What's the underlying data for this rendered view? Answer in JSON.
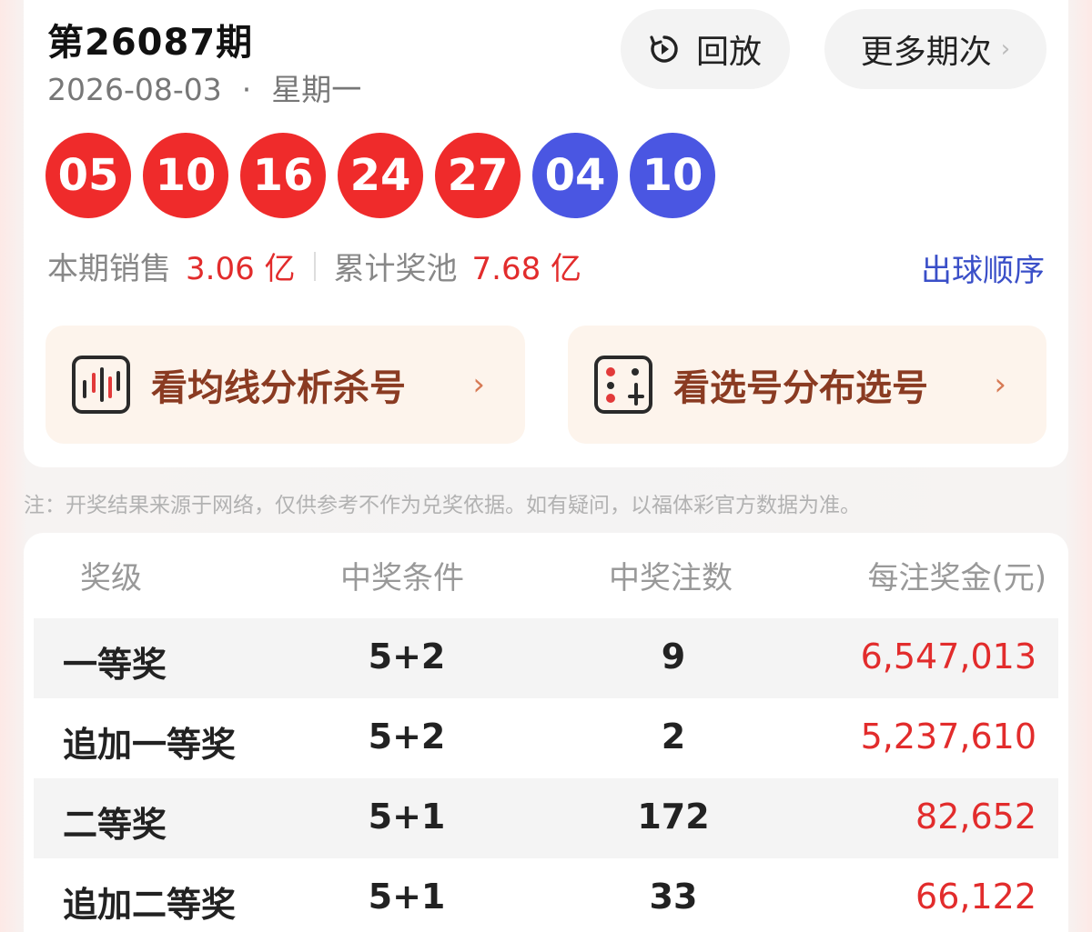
{
  "header": {
    "issue_title": "第26087期",
    "date": "2026-08-03",
    "dot": "·",
    "weekday": "星期一",
    "replay_label": "回放",
    "more_label": "更多期次",
    "more_chevron": "›"
  },
  "balls": [
    {
      "num": "05",
      "color": "#ef2b2b"
    },
    {
      "num": "10",
      "color": "#ef2b2b"
    },
    {
      "num": "16",
      "color": "#ef2b2b"
    },
    {
      "num": "24",
      "color": "#ef2b2b"
    },
    {
      "num": "27",
      "color": "#ef2b2b"
    },
    {
      "num": "04",
      "color": "#4a56e2"
    },
    {
      "num": "10",
      "color": "#4a56e2"
    }
  ],
  "stats": {
    "sales_label": "本期销售",
    "sales_value": "3.06 亿",
    "pool_label": "累计奖池",
    "pool_value": "7.68 亿",
    "order_link": "出球顺序"
  },
  "banners": [
    {
      "text": "看均线分析杀号",
      "icon": "chart-lines-icon",
      "chevron": "›"
    },
    {
      "text": "看选号分布选号",
      "icon": "dice-distribution-icon",
      "chevron": "›"
    }
  ],
  "note": "注：开奖结果来源于网络，仅供参考不作为兑奖依据。如有疑问，以福体彩官方数据为准。",
  "table": {
    "headers": [
      "奖级",
      "中奖条件",
      "中奖注数",
      "每注奖金(元)"
    ],
    "rows": [
      {
        "level": "一等奖",
        "cond": "5+2",
        "count": "9",
        "prize": "6,547,013"
      },
      {
        "level": "追加一等奖",
        "cond": "5+2",
        "count": "2",
        "prize": "5,237,610"
      },
      {
        "level": "二等奖",
        "cond": "5+1",
        "count": "172",
        "prize": "82,652"
      },
      {
        "level": "追加二等奖",
        "cond": "5+1",
        "count": "33",
        "prize": "66,122"
      }
    ]
  },
  "colors": {
    "red": "#e22c2c",
    "blue": "#4a56e2",
    "link": "#3a4fc8"
  }
}
